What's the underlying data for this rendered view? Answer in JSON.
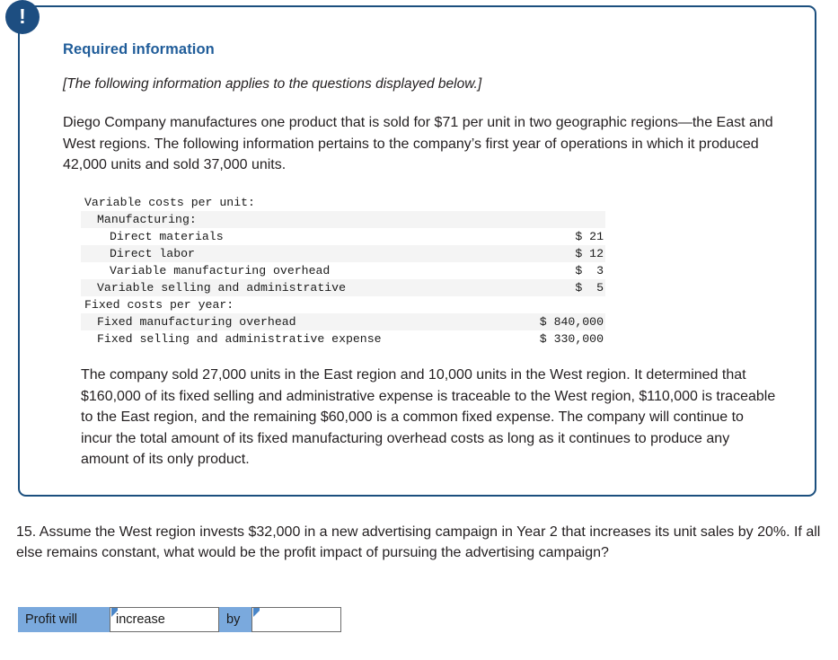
{
  "panel": {
    "badge_icon": "exclamation-icon",
    "badge_glyph": "!",
    "title": "Required information",
    "applies_note": "[The following information applies to the questions displayed below.]",
    "intro_paragraph": "Diego Company manufactures one product that is sold for $71 per unit in two geographic regions—the East and West regions. The following information pertains to the company’s first year of operations in which it produced 42,000 units and sold 37,000 units.",
    "region_paragraph": "The company sold 27,000 units in the East region and 10,000 units in the West region. It determined that $160,000 of its fixed selling and administrative expense is traceable to the West region, $110,000 is traceable to the East region, and the remaining $60,000 is a common fixed expense. The company will continue to incur the total amount of its fixed manufacturing overhead costs as long as it continues to produce any amount of its only product."
  },
  "cost_table": {
    "rows": [
      {
        "label": "Variable costs per unit:",
        "value": "",
        "indent": 0,
        "shaded": false
      },
      {
        "label": "Manufacturing:",
        "value": "",
        "indent": 1,
        "shaded": true
      },
      {
        "label": "Direct materials",
        "value": "$ 21",
        "indent": 2,
        "shaded": false
      },
      {
        "label": "Direct labor",
        "value": "$ 12",
        "indent": 2,
        "shaded": true
      },
      {
        "label": "Variable manufacturing overhead",
        "value": "$  3",
        "indent": 2,
        "shaded": false
      },
      {
        "label": "Variable selling and administrative",
        "value": "$  5",
        "indent": 1,
        "shaded": true
      },
      {
        "label": "Fixed costs per year:",
        "value": "",
        "indent": 0,
        "shaded": false
      },
      {
        "label": "Fixed manufacturing overhead",
        "value": "$ 840,000",
        "indent": 1,
        "shaded": true
      },
      {
        "label": "Fixed selling and administrative expense",
        "value": "$ 330,000",
        "indent": 1,
        "shaded": false
      }
    ]
  },
  "question": {
    "text": "15. Assume the West region invests $32,000 in a new advertising campaign in Year 2 that increases its unit sales by 20%. If all else remains constant, what would be the profit impact of pursuing the advertising campaign?"
  },
  "answer_row": {
    "label_profit": "Profit will",
    "value_direction": "increase",
    "label_by": "by",
    "value_amount": "",
    "placeholder_amount": "",
    "cell_color": "#7aa9dd"
  },
  "colors": {
    "panel_border": "#1b4f7e",
    "badge": "#1d4e81",
    "title": "#1f5c99",
    "body_text": "#231f20",
    "table_stripe": "#f4f4f4",
    "answer_cell": "#7aa9dd",
    "field_marker": "#4a86c8"
  }
}
